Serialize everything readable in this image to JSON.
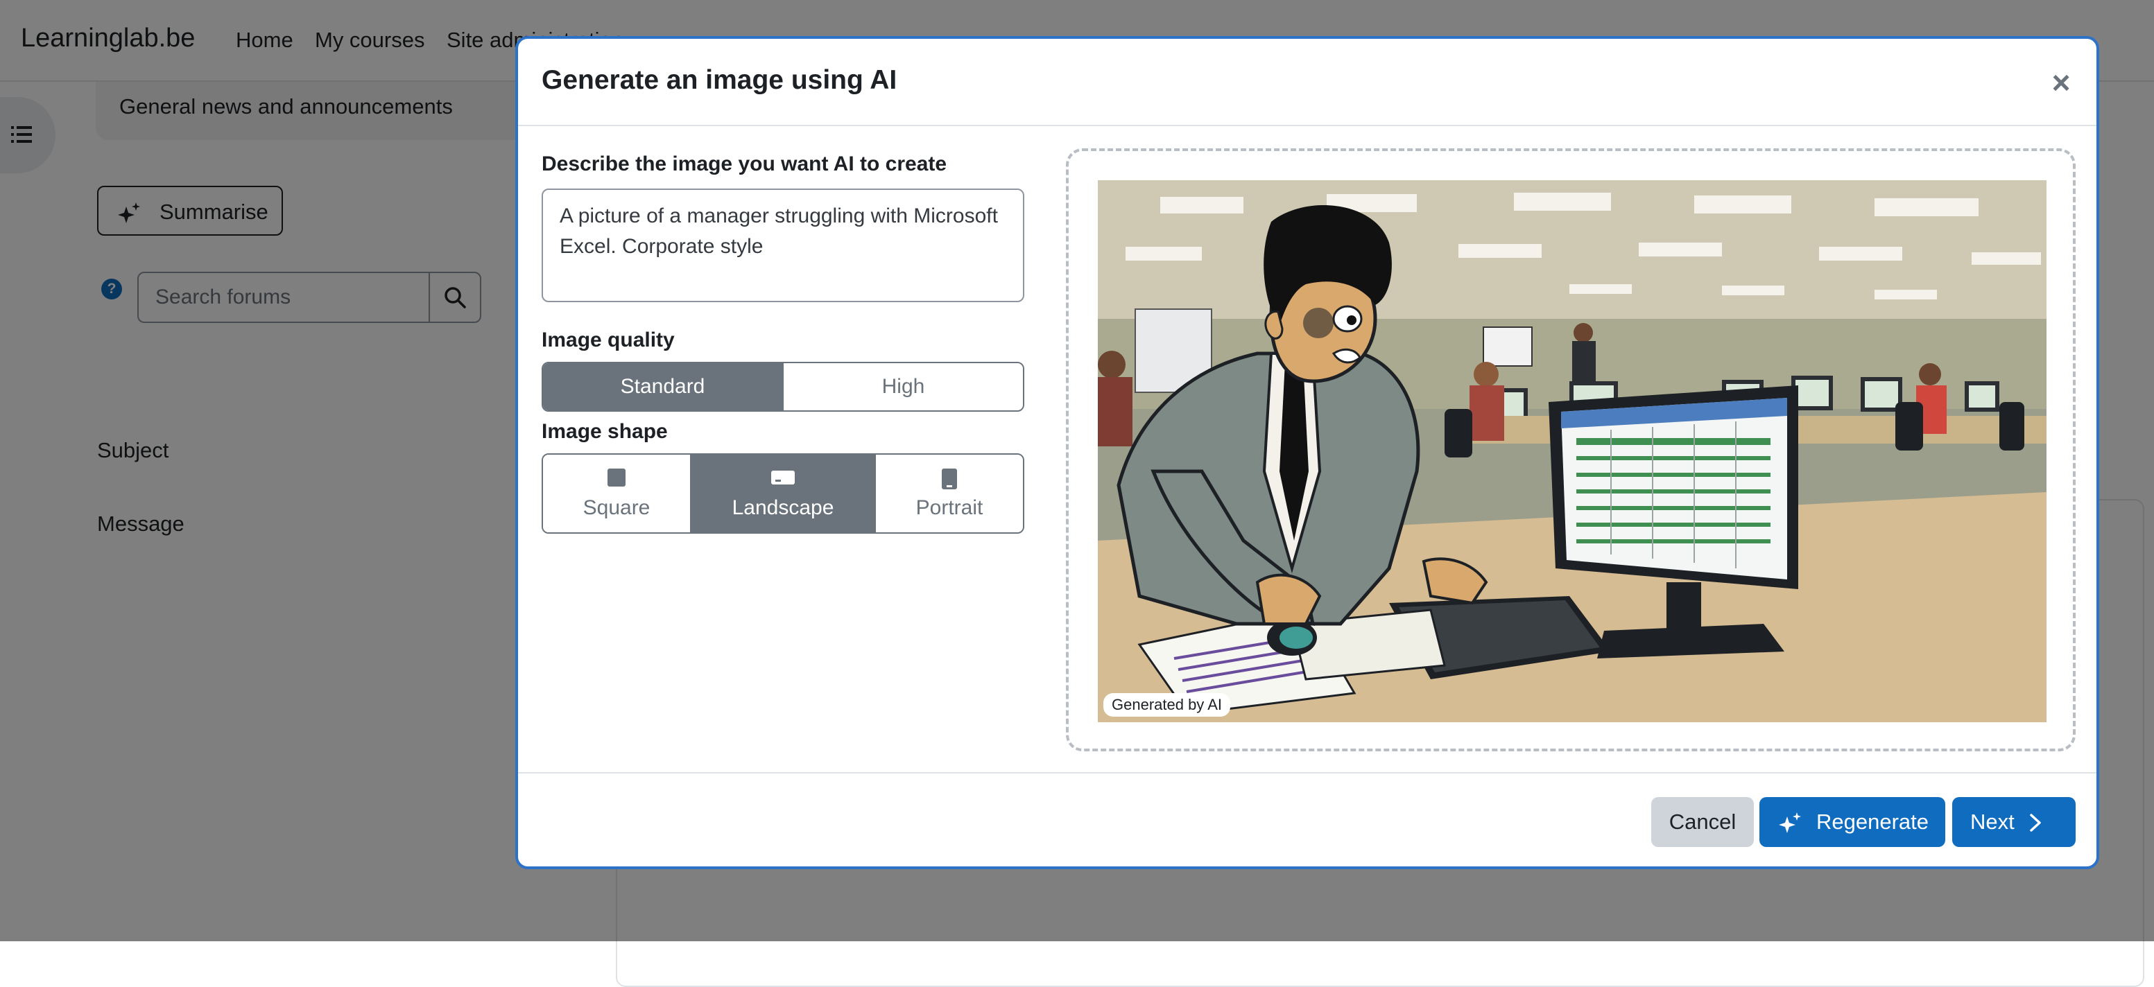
{
  "navbar": {
    "brand": "Learninglab.be",
    "links": [
      "Home",
      "My courses",
      "Site administration"
    ]
  },
  "page": {
    "forum_header": "General news and announcements",
    "summarise_label": "Summarise",
    "search_placeholder": "Search forums",
    "subject_label": "Subject",
    "message_label": "Message"
  },
  "modal": {
    "title": "Generate an image using AI",
    "prompt_label": "Describe the image you want AI to create",
    "prompt_value": "A picture of a manager struggling with Microsoft Excel. Corporate style",
    "quality_label": "Image quality",
    "quality_options": [
      {
        "label": "Standard",
        "selected": true
      },
      {
        "label": "High",
        "selected": false
      }
    ],
    "shape_label": "Image shape",
    "shape_options": [
      {
        "label": "Square",
        "icon": "square-shape-icon",
        "selected": false
      },
      {
        "label": "Landscape",
        "icon": "landscape-shape-icon",
        "selected": true
      },
      {
        "label": "Portrait",
        "icon": "portrait-shape-icon",
        "selected": false
      }
    ],
    "preview_badge": "Generated by AI",
    "buttons": {
      "cancel": "Cancel",
      "regenerate": "Regenerate",
      "next": "Next"
    }
  },
  "colors": {
    "primary": "#0f6cbf",
    "modal_border": "#2d72c9",
    "segment_active": "#6a737b",
    "cancel_bg": "#ced4da"
  }
}
